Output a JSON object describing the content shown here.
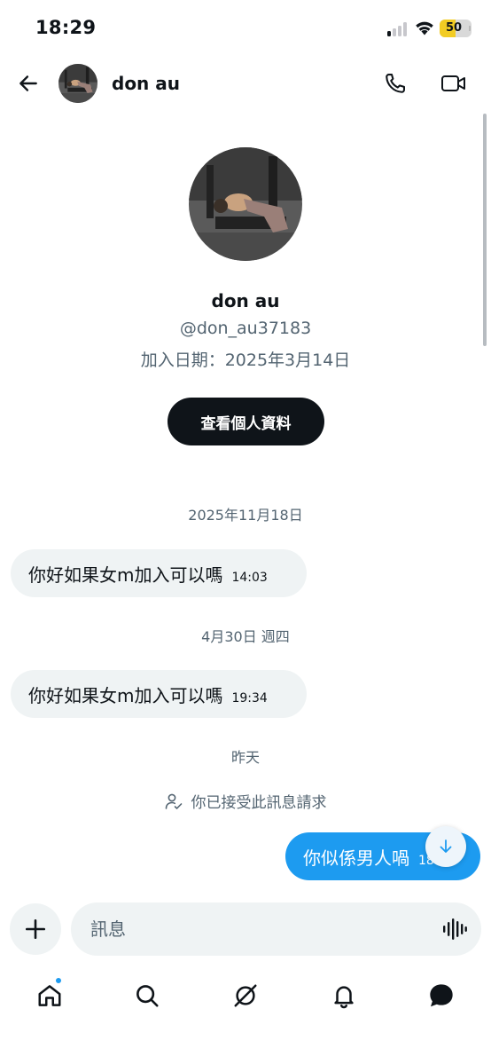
{
  "status_bar": {
    "time": "18:29",
    "battery": "50",
    "battery_level": 0.5
  },
  "header": {
    "name": "don au",
    "icons": {
      "back": "arrow-left-icon",
      "call": "phone-icon",
      "video": "video-camera-icon"
    }
  },
  "profile": {
    "name": "don au",
    "handle": "@don_au37183",
    "joined": "加入日期：2025年3月14日",
    "view_profile_label": "查看個人資料"
  },
  "messages": [
    {
      "type": "date",
      "text": "2025年11月18日"
    },
    {
      "type": "incoming",
      "text": "你好如果女m加入可以嗎",
      "time": "14:03"
    },
    {
      "type": "date",
      "text": "4月30日 週四"
    },
    {
      "type": "incoming",
      "text": "你好如果女m加入可以嗎",
      "time": "19:34"
    },
    {
      "type": "date",
      "text": "昨天"
    },
    {
      "type": "system",
      "text": "你已接受此訊息請求"
    },
    {
      "type": "outgoing",
      "text": "你似係男人喎",
      "time": "18:29"
    }
  ],
  "composer": {
    "placeholder": "訊息"
  },
  "colors": {
    "accent": "#1d9bf0",
    "text": "#0f1419",
    "secondary": "#536471",
    "bubble_in": "#eff3f4",
    "battery": "#f2cc23"
  },
  "nav": {
    "items": [
      "home-icon",
      "search-icon",
      "grok-icon",
      "bell-icon",
      "messages-icon"
    ],
    "active": "home"
  }
}
